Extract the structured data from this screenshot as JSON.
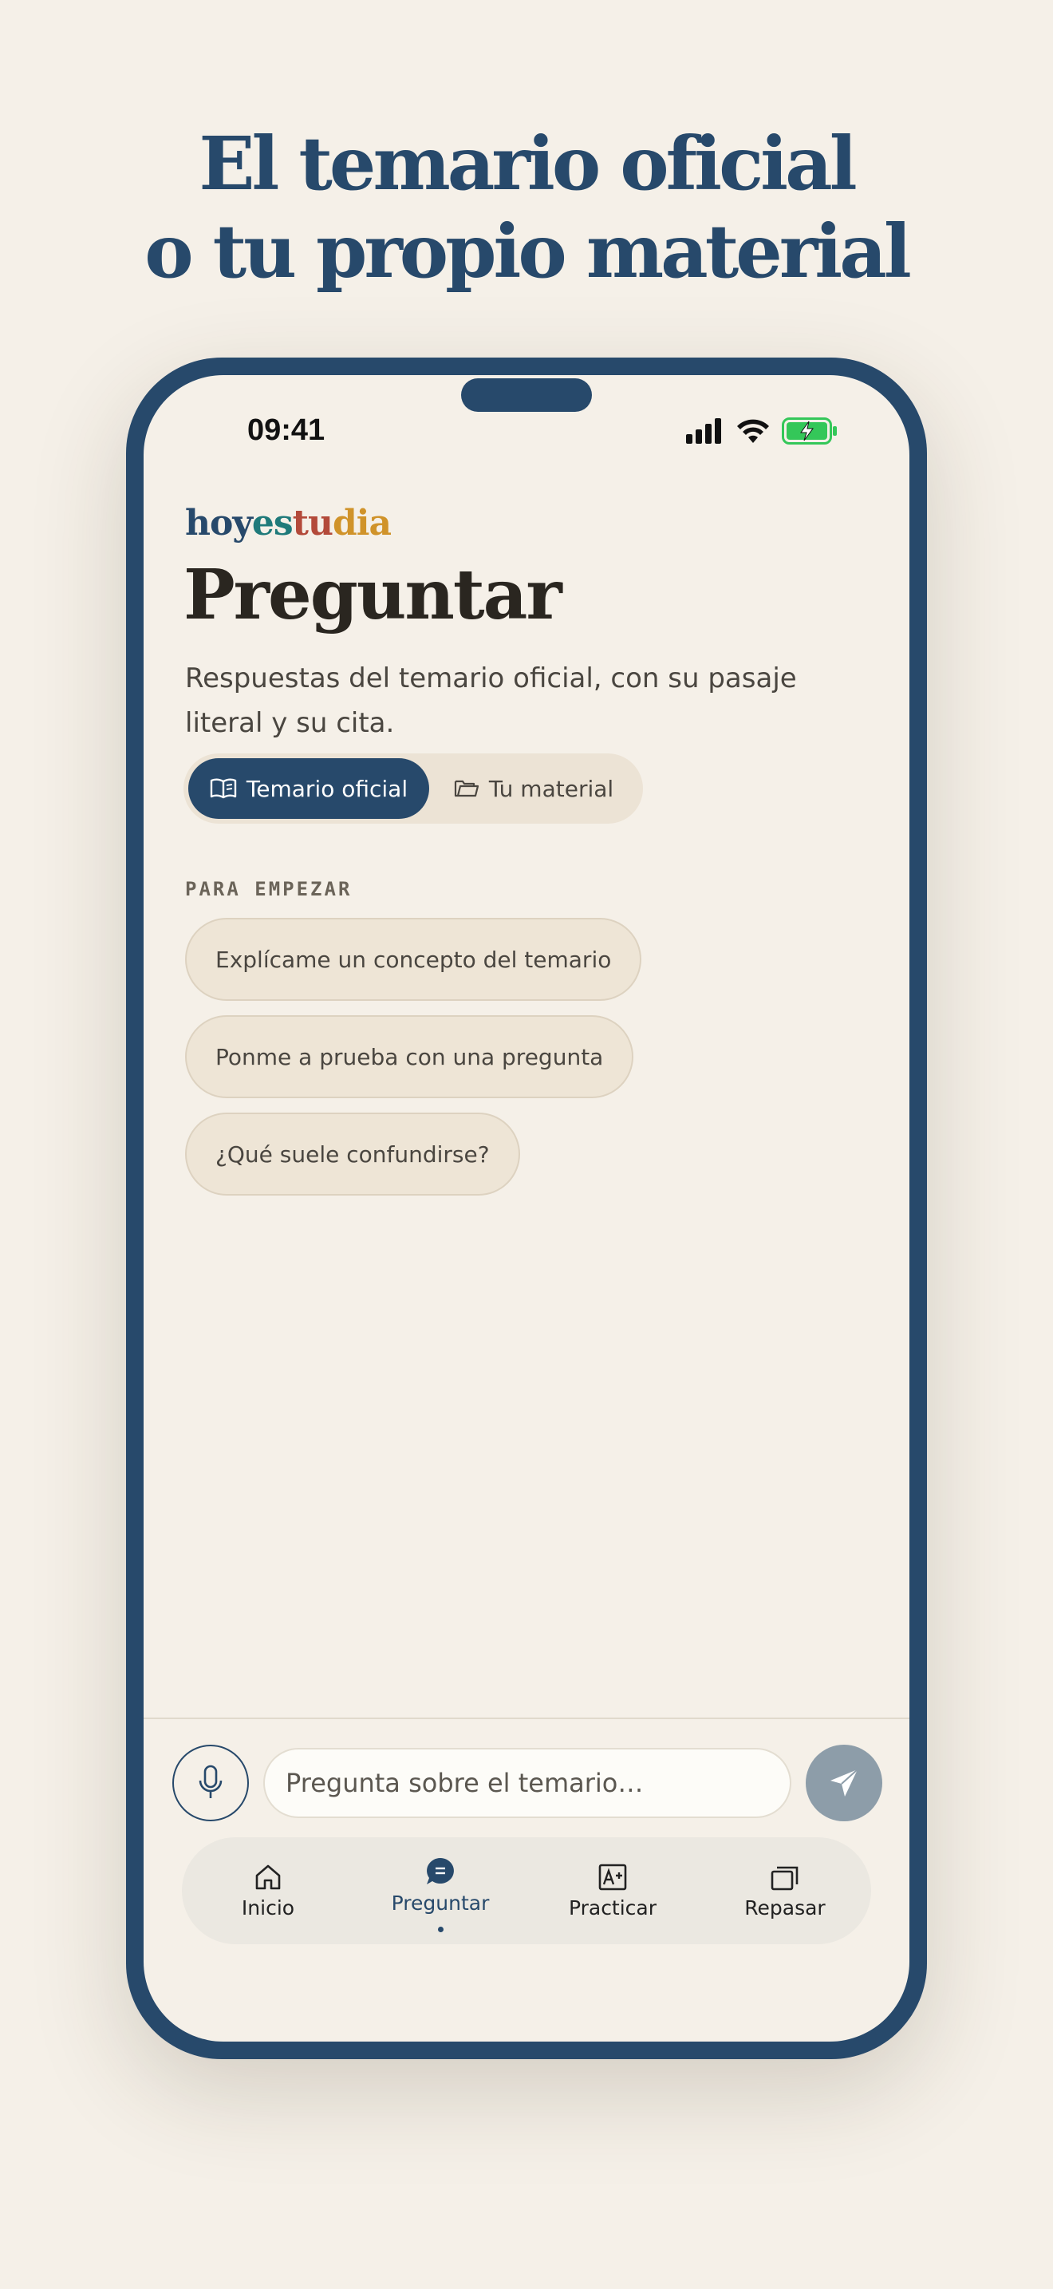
{
  "headline": {
    "line1": "El temario oficial",
    "line2": "o tu propio material"
  },
  "status_bar": {
    "time": "09:41",
    "battery_color": "#34c759"
  },
  "brand": {
    "part1": "hoy",
    "part2": "es",
    "part3": "tu",
    "part4": "dia"
  },
  "page": {
    "title": "Preguntar",
    "subtitle": "Respuestas del temario oficial, con su pasaje literal y su cita."
  },
  "source_toggle": {
    "options": [
      {
        "label": "Temario oficial",
        "icon": "open-book-icon",
        "selected": true
      },
      {
        "label": "Tu material",
        "icon": "folder-icon",
        "selected": false
      }
    ]
  },
  "suggestions": {
    "label": "PARA EMPEZAR",
    "items": [
      "Explícame un concepto del temario",
      "Ponme a prueba con una pregunta",
      "¿Qué suele confundirse?"
    ]
  },
  "composer": {
    "placeholder": "Pregunta sobre el temario…",
    "mic_icon": "microphone-icon",
    "send_icon": "send-icon"
  },
  "tabbar": {
    "tabs": [
      {
        "label": "Inicio",
        "icon": "home-icon",
        "active": false
      },
      {
        "label": "Preguntar",
        "icon": "chat-bubble-icon",
        "active": true
      },
      {
        "label": "Practicar",
        "icon": "grade-a-plus-icon",
        "active": false
      },
      {
        "label": "Repasar",
        "icon": "cards-stack-icon",
        "active": false
      }
    ]
  },
  "colors": {
    "brand_navy": "#27496b",
    "background": "#f5f0e8",
    "chip_bg": "#eee5d6"
  }
}
